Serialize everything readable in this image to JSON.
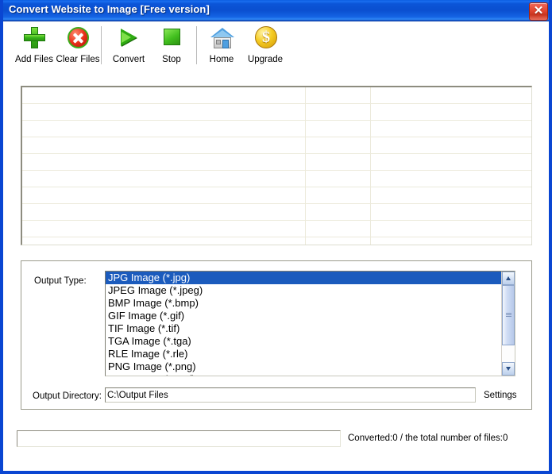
{
  "window": {
    "title": "Convert Website to Image [Free version]",
    "close_glyph": "✕",
    "accent_color": "#0a4fd0",
    "selection_color": "#1b5bbd"
  },
  "toolbar": {
    "items": [
      {
        "label": "Add Files",
        "icon": "plus-icon"
      },
      {
        "label": "Clear Files",
        "icon": "clear-icon"
      },
      {
        "label": "Convert",
        "icon": "play-icon"
      },
      {
        "label": "Stop",
        "icon": "stop-icon"
      },
      {
        "label": "Home",
        "icon": "home-icon"
      },
      {
        "label": "Upgrade",
        "icon": "coin-icon"
      }
    ]
  },
  "file_list": {
    "rows": [],
    "row_count": 9,
    "column_dividers": [
      356,
      438
    ]
  },
  "options": {
    "output_type_label": "Output Type:",
    "output_types": [
      "JPG Image (*.jpg)",
      "JPEG Image (*.jpeg)",
      "BMP Image (*.bmp)",
      "GIF Image (*.gif)",
      "TIF Image (*.tif)",
      "TGA Image (*.tga)",
      "RLE Image (*.rle)",
      "PNG Image (*.png)",
      "EMF Image (*.emf)"
    ],
    "selected_output_type": "JPG Image (*.jpg)",
    "output_dir_label": "Output Directory:",
    "output_dir_value": "C:\\Output Files",
    "output_dir_placeholder": "",
    "settings_label": "Settings"
  },
  "status": {
    "progress_percent": 0,
    "text": "Converted:0  /  the total number of files:0"
  }
}
